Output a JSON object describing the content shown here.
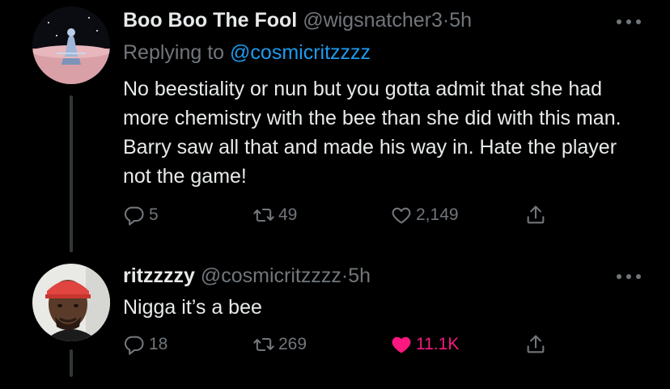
{
  "tweet1": {
    "display_name": "Boo Boo The Fool",
    "handle": "@wigsnatcher3",
    "separator": "·",
    "time": "5h",
    "replying_prefix": "Replying to",
    "replying_to": "@cosmicritzzzz",
    "text": "No beestiality or nun but you gotta admit that she had more chemistry with the bee than she did with this man. Barry saw all that and made his way in. Hate the player not the game!",
    "replies": "5",
    "retweets": "49",
    "likes": "2,149",
    "liked": false
  },
  "tweet2": {
    "display_name": "ritzzzzy",
    "handle": "@cosmicritzzzz",
    "separator": "·",
    "time": "5h",
    "text": "Nigga it’s a bee",
    "replies": "18",
    "retweets": "269",
    "likes": "11.1K",
    "liked": true
  },
  "colors": {
    "background": "#000000",
    "text_primary": "#e7e9ea",
    "text_secondary": "#71767b",
    "link": "#1d9bf0",
    "like_active": "#f91880"
  },
  "icons": [
    "reply-icon",
    "retweet-icon",
    "like-icon",
    "share-icon",
    "more-icon"
  ]
}
